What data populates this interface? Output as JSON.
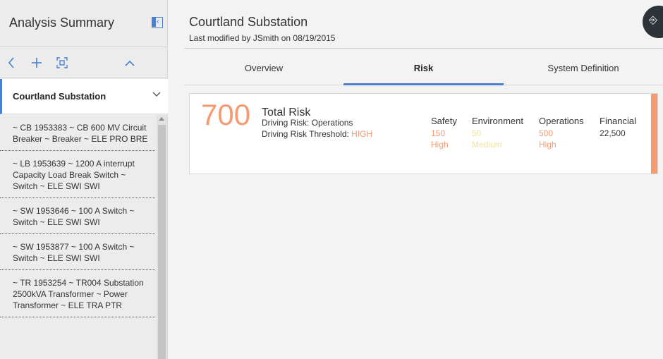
{
  "sidebar": {
    "title": "Analysis Summary",
    "root": "Courtland Substation",
    "items": [
      "~ CB 1953383 ~ CB 600 MV Circuit Breaker ~ Breaker ~ ELE PRO BRE",
      "~ LB 1953639 ~ 1200 A interrupt Capacity Load Break Switch ~ Switch ~ ELE SWI SWI",
      "~ SW 1953646 ~ 100 A Switch ~ Switch ~ ELE SWI SWI",
      "~ SW 1953877 ~ 100 A Switch ~ Switch ~ ELE SWI SWI",
      "~ TR 1953254 ~ TR004 Substation 2500kVA Transformer ~ Power Transformer ~ ELE TRA PTR"
    ]
  },
  "header": {
    "title": "Courtland Substation",
    "subtitle": "Last modified by JSmith on 08/19/2015"
  },
  "tabs": [
    "Overview",
    "Risk",
    "System Definition"
  ],
  "risk": {
    "total": "700",
    "label": "Total Risk",
    "driving": "Driving Risk: Operations",
    "threshold_label": "Driving Risk Threshold:",
    "threshold_value": "HIGH",
    "metrics": [
      {
        "name": "Safety",
        "value": "150",
        "level": "High"
      },
      {
        "name": "Environment",
        "value": "50",
        "level": "Medium"
      },
      {
        "name": "Operations",
        "value": "500",
        "level": "High"
      },
      {
        "name": "Financial",
        "value": "22,500",
        "level": ""
      }
    ]
  },
  "colors": {
    "accent": "#4a7fd1",
    "high": "#f59a71",
    "medium": "#ede4a4"
  },
  "icons": [
    "collapse-panel-icon",
    "back-icon",
    "add-icon",
    "focus-icon",
    "chevron-up-icon",
    "chevron-down-icon",
    "exit-icon"
  ]
}
